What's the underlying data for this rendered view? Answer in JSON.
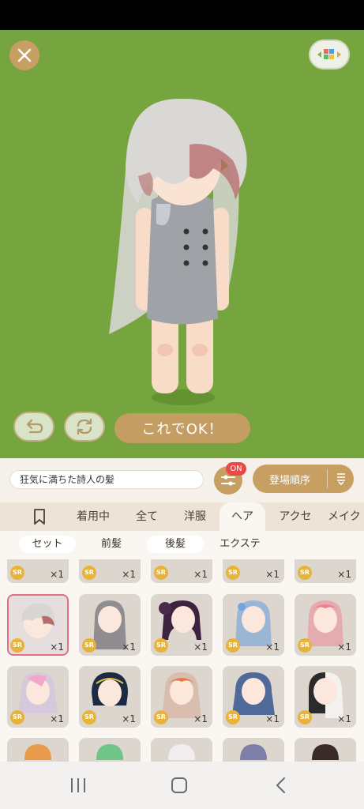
{
  "stage": {
    "confirm_label": "これでOK！"
  },
  "filter": {
    "search_value": "狂気に満ちた詩人の髪",
    "on_badge": "ON",
    "sort_label": "登場順序"
  },
  "tabs": [
    "着用中",
    "全て",
    "洋服",
    "ヘア",
    "アクセ",
    "メイク"
  ],
  "subtabs": [
    "セット",
    "前髪",
    "後髪",
    "エクステ"
  ],
  "items": {
    "rarity": "SR",
    "qty": "×1"
  },
  "colors": {
    "stage_bg": "#76a43e",
    "accent": "#c89f62",
    "selected_border": "#e66f85"
  }
}
